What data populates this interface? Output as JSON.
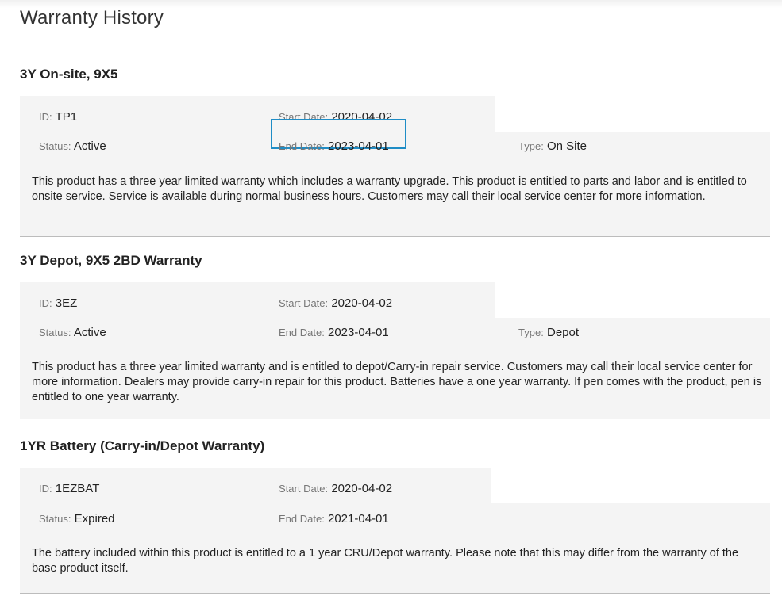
{
  "page": {
    "title": "Warranty History"
  },
  "labels": {
    "id": "ID",
    "start_date": "Start Date",
    "end_date": "End Date",
    "status": "Status",
    "type": "Type"
  },
  "warranties": [
    {
      "name": "3Y On-site, 9X5",
      "id": "TP1",
      "start_date": "2020-04-02",
      "status": "Active",
      "end_date": "2023-04-01",
      "type": "On Site",
      "end_date_highlighted": true,
      "description": "This product has a three year limited warranty which includes a warranty upgrade. This product is entitled to parts and labor and is entitled to onsite service. Service is available during normal business hours. Customers may call their local service center for more information."
    },
    {
      "name": "3Y Depot, 9X5 2BD Warranty",
      "id": "3EZ",
      "start_date": "2020-04-02",
      "status": "Active",
      "end_date": "2023-04-01",
      "type": "Depot",
      "description": "This product has a three year limited warranty and is entitled to depot/Carry-in repair service. Customers may call their local service center for more information. Dealers may provide carry-in repair for this product. Batteries have a one year warranty. If pen comes with the product, pen is entitled to one year warranty."
    },
    {
      "name": "1YR Battery (Carry-in/Depot Warranty)",
      "id": "1EZBAT",
      "start_date": "2020-04-02",
      "status": "Expired",
      "end_date": "2021-04-01",
      "description": "The battery included within this product is entitled to a 1 year CRU/Depot warranty. Please note that this may differ from the warranty of the base product itself."
    }
  ],
  "colors": {
    "card_background": "#f4f4f4",
    "highlight_border": "#1f8dc6",
    "divider": "#bcbcbc",
    "label_text": "#777777"
  }
}
